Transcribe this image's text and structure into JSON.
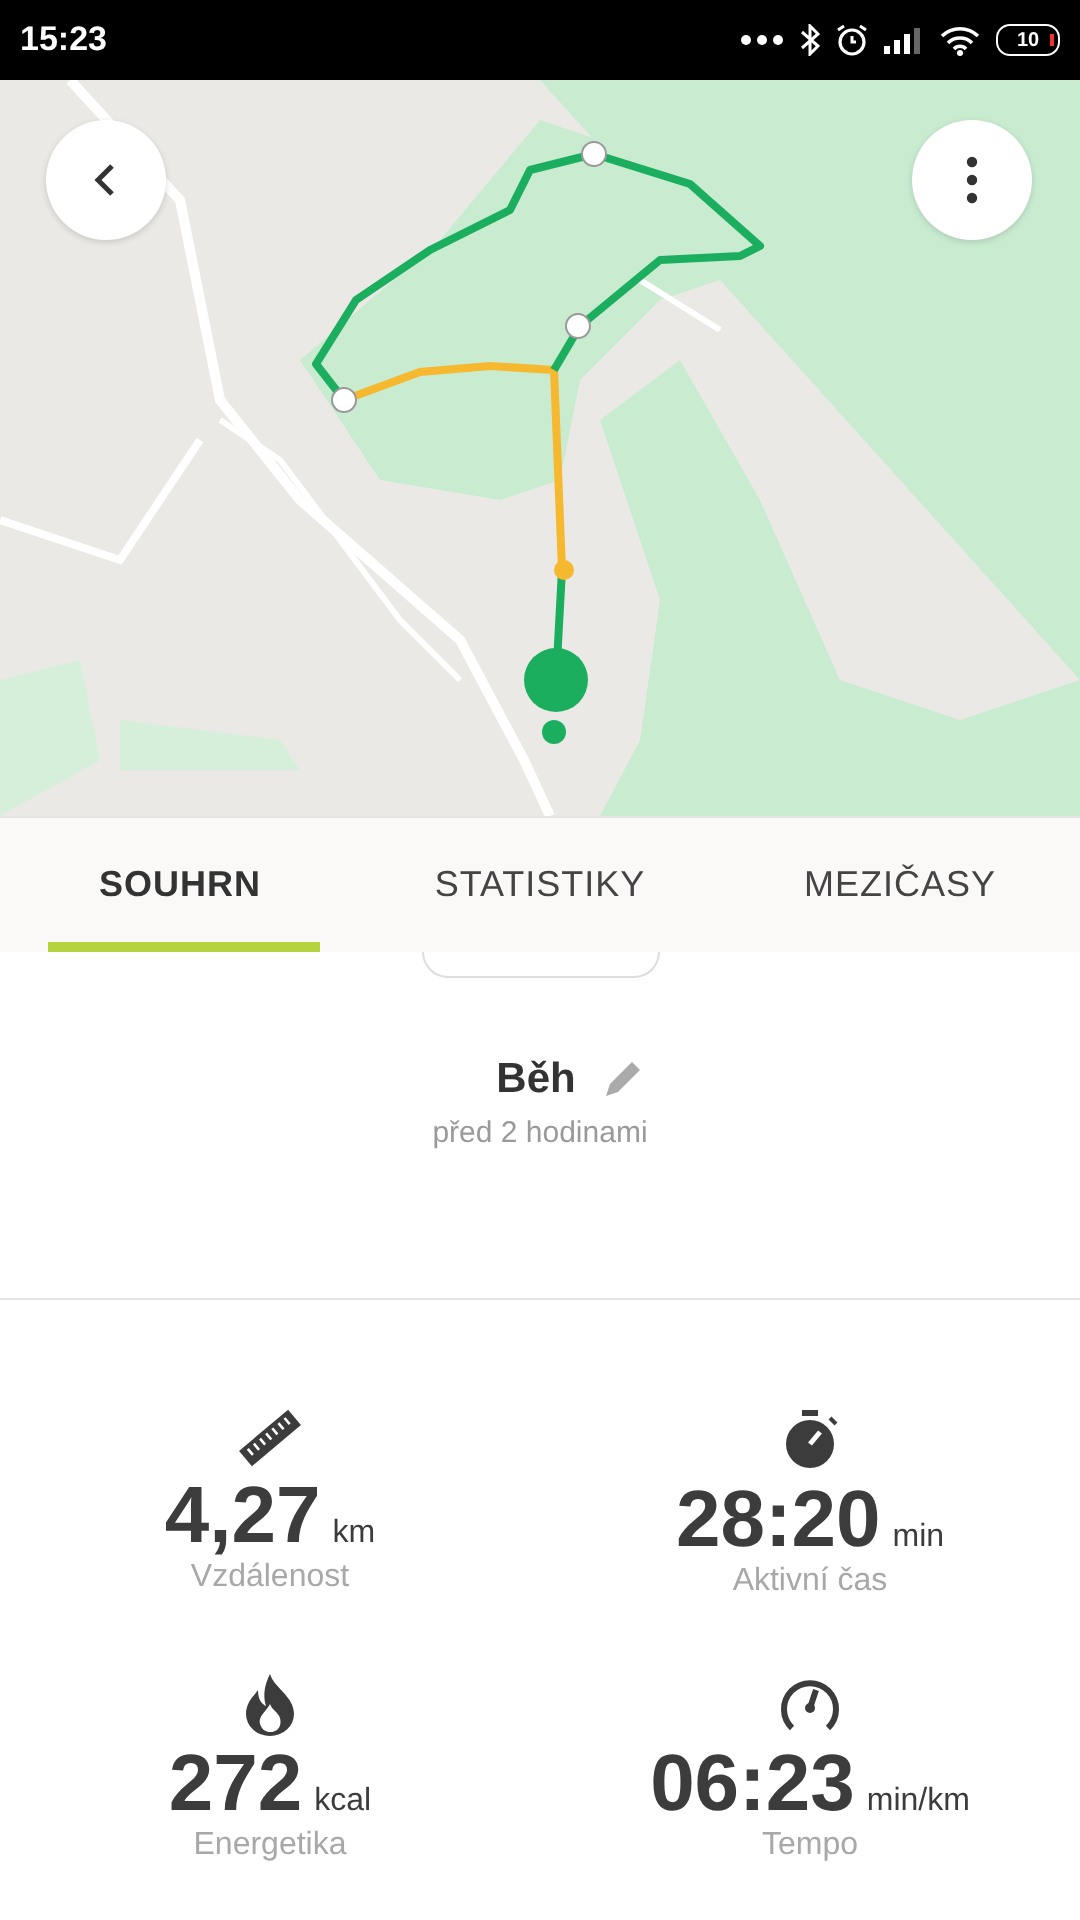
{
  "status_bar": {
    "time": "15:23",
    "battery": "10"
  },
  "tabs": [
    {
      "label": "SOUHRN",
      "selected": true
    },
    {
      "label": "STATISTIKY",
      "selected": false
    },
    {
      "label": "MEZIČASY",
      "selected": false
    }
  ],
  "activity": {
    "title": "Běh",
    "subtitle": "před 2 hodinami"
  },
  "stats": [
    {
      "kind": "distance",
      "value": "4,27",
      "unit": "km",
      "label": "Vzdálenost"
    },
    {
      "kind": "time",
      "value": "28:20",
      "unit": "min",
      "label": "Aktivní čas"
    },
    {
      "kind": "energy",
      "value": "272",
      "unit": "kcal",
      "label": "Energetika"
    },
    {
      "kind": "pace",
      "value": "06:23",
      "unit": "min/km",
      "label": "Tempo"
    }
  ]
}
